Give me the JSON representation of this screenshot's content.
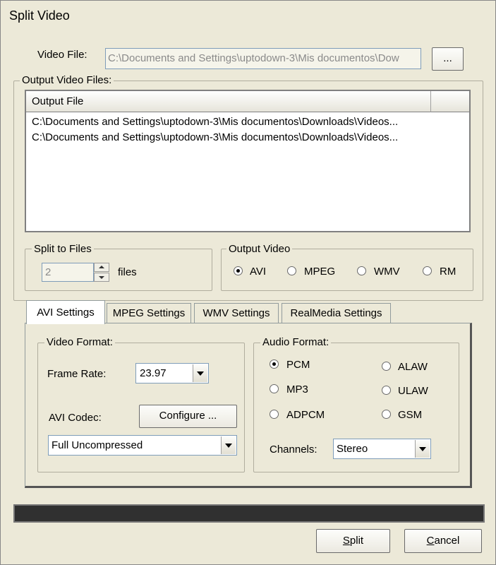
{
  "window": {
    "title": "Split Video"
  },
  "video_file": {
    "label": "Video File:",
    "value": "C:\\Documents and Settings\\uptodown-3\\Mis documentos\\Dow",
    "browse_label": "..."
  },
  "output_files": {
    "group_label": "Output Video Files:",
    "column_header": "Output File",
    "rows": [
      "C:\\Documents and Settings\\uptodown-3\\Mis documentos\\Downloads\\Videos...",
      "C:\\Documents and Settings\\uptodown-3\\Mis documentos\\Downloads\\Videos..."
    ]
  },
  "split": {
    "group_label": "Split to Files",
    "value": "2",
    "unit": "files"
  },
  "output_video": {
    "group_label": "Output Video",
    "options": [
      "AVI",
      "MPEG",
      "WMV",
      "RM"
    ],
    "selected": "AVI"
  },
  "tabs": [
    {
      "label": "AVI Settings",
      "active": true
    },
    {
      "label": "MPEG Settings",
      "active": false
    },
    {
      "label": "WMV Settings",
      "active": false
    },
    {
      "label": "RealMedia Settings",
      "active": false
    }
  ],
  "video_format": {
    "group_label": "Video Format:",
    "frame_rate_label": "Frame Rate:",
    "frame_rate_value": "23.97",
    "codec_label": "AVI Codec:",
    "configure_label": "Configure ...",
    "codec_value": "Full Uncompressed"
  },
  "audio_format": {
    "group_label": "Audio Format:",
    "options": [
      "PCM",
      "MP3",
      "ADPCM",
      "ALAW",
      "ULAW",
      "GSM"
    ],
    "selected": "PCM",
    "channels_label": "Channels:",
    "channels_value": "Stereo"
  },
  "progress": {
    "value": 0
  },
  "buttons": {
    "split_prefix": "",
    "split_mnemonic": "S",
    "split_rest": "plit",
    "cancel_prefix": "",
    "cancel_mnemonic": "C",
    "cancel_rest": "ancel"
  }
}
